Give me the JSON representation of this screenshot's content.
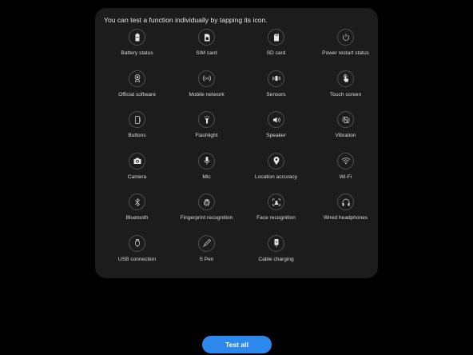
{
  "intro_text": "You can test a function individually by tapping its icon.",
  "tests": [
    {
      "label": "Battery status",
      "icon": "battery-icon"
    },
    {
      "label": "SIM card",
      "icon": "sim-card-icon"
    },
    {
      "label": "SD card",
      "icon": "sd-card-icon"
    },
    {
      "label": "Power restart status",
      "icon": "power-restart-icon"
    },
    {
      "label": "Official software",
      "icon": "official-software-icon"
    },
    {
      "label": "Mobile network",
      "icon": "mobile-network-icon"
    },
    {
      "label": "Sensors",
      "icon": "sensors-icon"
    },
    {
      "label": "Touch screen",
      "icon": "touch-screen-icon"
    },
    {
      "label": "Buttons",
      "icon": "buttons-icon"
    },
    {
      "label": "Flashlight",
      "icon": "flashlight-icon"
    },
    {
      "label": "Speaker",
      "icon": "speaker-icon"
    },
    {
      "label": "Vibration",
      "icon": "vibration-icon"
    },
    {
      "label": "Camera",
      "icon": "camera-icon"
    },
    {
      "label": "Mic",
      "icon": "mic-icon"
    },
    {
      "label": "Location accuracy",
      "icon": "location-icon"
    },
    {
      "label": "Wi-Fi",
      "icon": "wifi-icon"
    },
    {
      "label": "Bluetooth",
      "icon": "bluetooth-icon"
    },
    {
      "label": "Fingerprint recognition",
      "icon": "fingerprint-icon"
    },
    {
      "label": "Face recognition",
      "icon": "face-recognition-icon"
    },
    {
      "label": "Wired headphones",
      "icon": "headphones-icon"
    },
    {
      "label": "USB connection",
      "icon": "usb-connection-icon"
    },
    {
      "label": "S Pen",
      "icon": "s-pen-icon"
    },
    {
      "label": "Cable charging",
      "icon": "cable-charging-icon"
    }
  ],
  "test_all_label": "Test all",
  "colors": {
    "background": "#000000",
    "panel": "#1c1c1c",
    "accent": "#2d88ee"
  }
}
